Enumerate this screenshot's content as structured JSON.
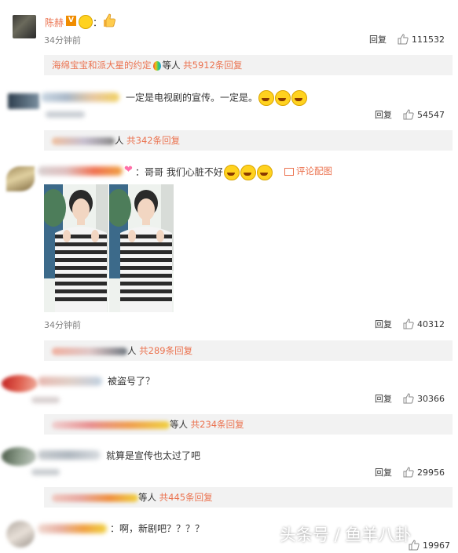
{
  "comments": [
    {
      "username": "陈赫",
      "text_suffix": "：",
      "time": "34分钟前",
      "reply_label": "回复",
      "likes": "111532",
      "replies": {
        "prefix": "海绵宝宝和派大星的约定",
        "suffix": "等人",
        "count": "共5912条回复"
      }
    },
    {
      "text": "一定是电视剧的宣传。一定是。",
      "reply_label": "回复",
      "likes": "54547",
      "replies": {
        "suffix": "人",
        "count": "共342条回复"
      }
    },
    {
      "text": "：哥哥 我们心脏不好",
      "view_image_label": "评论配图",
      "time": "34分钟前",
      "reply_label": "回复",
      "likes": "40312",
      "replies": {
        "suffix": "人",
        "count": "共289条回复"
      }
    },
    {
      "text": "被盗号了？",
      "reply_label": "回复",
      "likes": "30366",
      "replies": {
        "suffix": "等人",
        "count": "共234条回复"
      }
    },
    {
      "text": "就算是宣传也太过了吧",
      "reply_label": "回复",
      "likes": "29956",
      "replies": {
        "suffix": "等人",
        "count": "共445条回复"
      }
    },
    {
      "text": "：啊，新剧吧？？？？",
      "likes": "19967"
    }
  ],
  "watermark": "头条号 / 鱼羊八卦",
  "colors": {
    "accent": "#eb7350",
    "username": "#eb7350",
    "reply_bg": "#f2f2f2",
    "muted": "#808080"
  }
}
